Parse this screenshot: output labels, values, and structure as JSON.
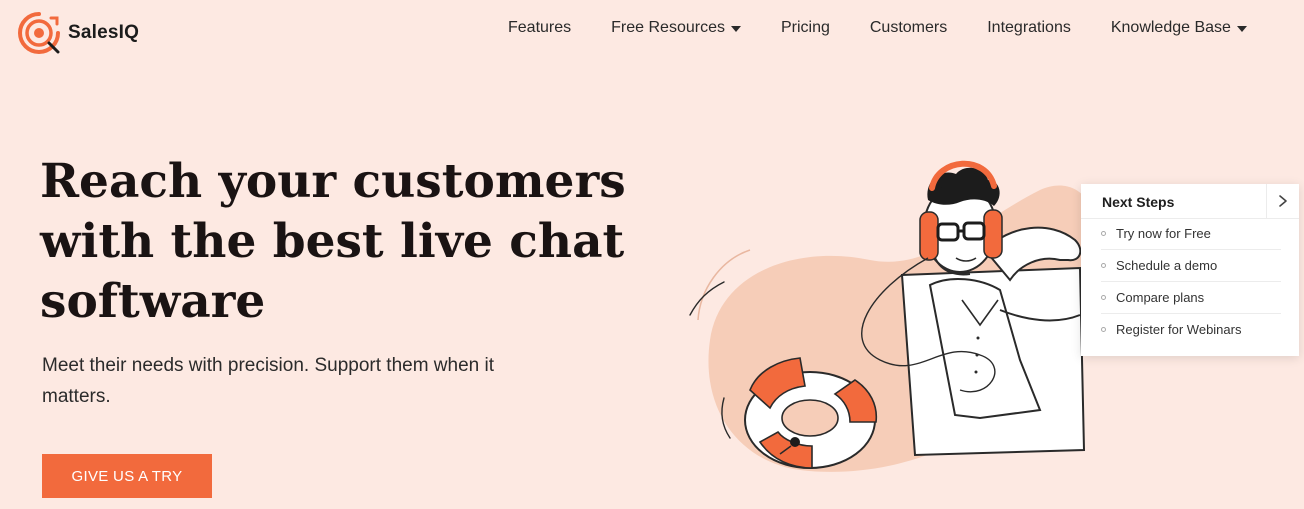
{
  "brand": {
    "name": "SalesIQ",
    "accent": "#f26a3d",
    "background": "#fde9e2"
  },
  "nav": {
    "items": [
      {
        "label": "Features",
        "icon": ""
      },
      {
        "label": "Free Resources",
        "icon": "caret-down-icon"
      },
      {
        "label": "Pricing",
        "icon": ""
      },
      {
        "label": "Customers",
        "icon": ""
      },
      {
        "label": "Integrations",
        "icon": ""
      },
      {
        "label": "Knowledge Base",
        "icon": "caret-down-icon"
      }
    ]
  },
  "hero": {
    "title": "Reach your customers with the best live chat software",
    "subtitle": "Meet their needs with precision. Support them when it matters.",
    "cta_label": "GIVE US A TRY"
  },
  "next_steps": {
    "title": "Next Steps",
    "toggle_icon": "chevron-right-icon",
    "items": [
      "Try now for Free",
      "Schedule a demo",
      "Compare plans",
      "Register for Webinars"
    ]
  }
}
